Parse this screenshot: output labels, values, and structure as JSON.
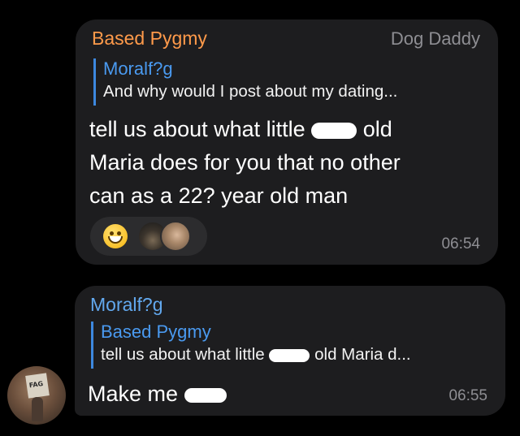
{
  "messages": [
    {
      "sender": "Based Pygmy",
      "sender_tag": "Dog Daddy",
      "reply_name": "Moralf?g",
      "reply_text": "And why would I post about my dating...",
      "text_part1": "tell us about what little",
      "text_part2": "old",
      "text_part3": "Maria does for you that no other",
      "text_part4": "can as a 22? year old man",
      "reaction_icon": "grinning-face-emoji",
      "time": "06:54",
      "colors": {
        "sender": "#ff9a4a",
        "bubble": "#1d1d1f"
      }
    },
    {
      "sender": "Moralf?g",
      "reply_name": "Based Pygmy",
      "reply_text_part1": "tell us about what little",
      "reply_text_part2": "old Maria d...",
      "text": "Make me",
      "time": "06:55",
      "colors": {
        "sender": "#62a8ee",
        "reply_bar": "#3d88df"
      }
    }
  ],
  "avatar": {
    "sign_text": "FAG",
    "icon": "user-avatar"
  }
}
